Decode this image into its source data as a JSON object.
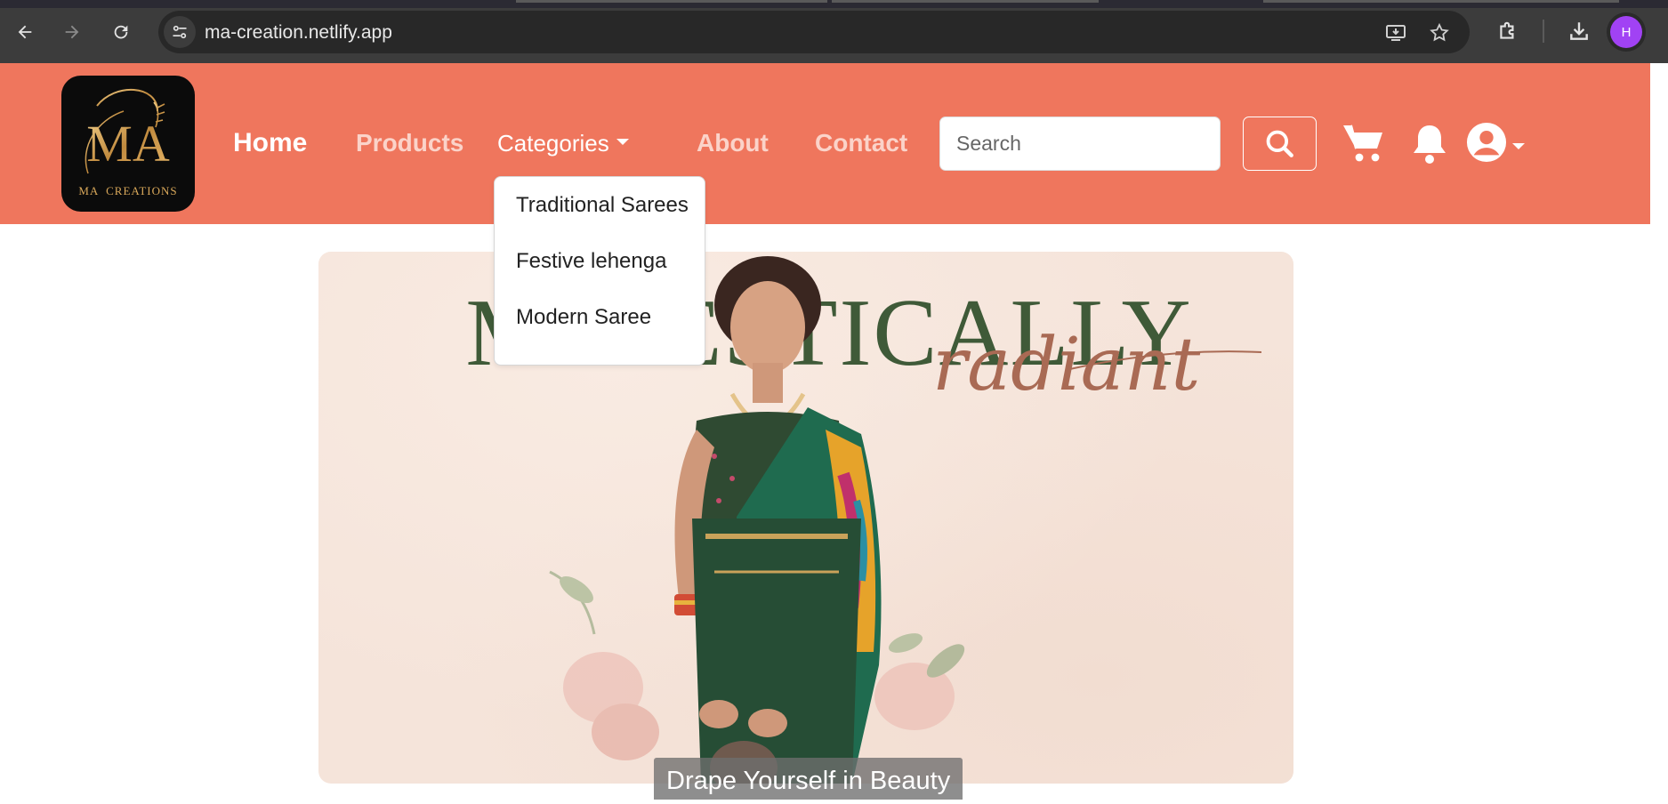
{
  "browser": {
    "url": "ma-creation.netlify.app",
    "profile_initial": "H",
    "profile_color": "#a142f4"
  },
  "navbar": {
    "background": "#ef765d",
    "logo": {
      "monogram": "MA",
      "text": "MA  CREATIONS"
    },
    "links": {
      "home": "Home",
      "products": "Products",
      "categories": "Categories",
      "about": "About",
      "contact": "Contact"
    },
    "search": {
      "placeholder": "Search",
      "value": ""
    },
    "icons": [
      "search-icon",
      "cart-icon",
      "bell-icon",
      "user-circle-icon"
    ]
  },
  "categories_dropdown": {
    "items": [
      "Traditional Sarees",
      "Festive lehenga",
      "Modern Saree"
    ]
  },
  "hero": {
    "headline": "MAJESTICALLY",
    "script": "radiant",
    "caption": "Drape Yourself in Beauty"
  }
}
